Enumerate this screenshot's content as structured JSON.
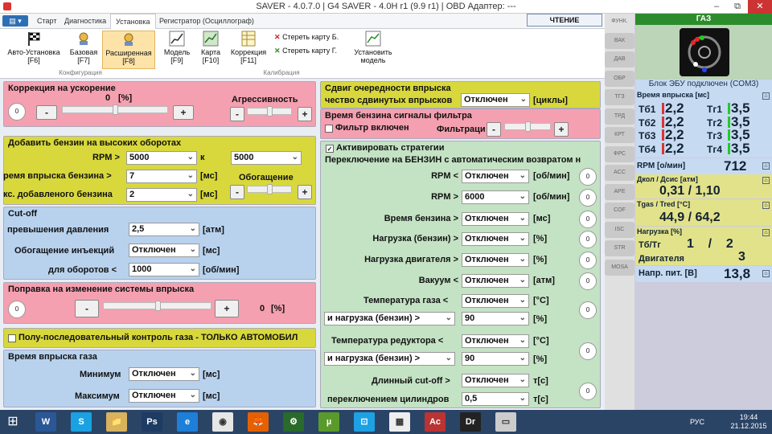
{
  "window": {
    "title": "SAVER - 4.0.7.0  |  G4 SAVER - 4.0H r1 (9.9 r1)  |  OBD Адаптер: ---",
    "min": "–",
    "max": "▭",
    "restore": "⧉",
    "close": "✕"
  },
  "menu": {
    "label": "▤ ▾"
  },
  "tabs": [
    "Старт",
    "Диагностика",
    "Установка",
    "Регистратор (Осциллограф)"
  ],
  "read_button": "ЧТЕНИЕ",
  "ribbon": {
    "auto": "Авто-Установка\n[F6]",
    "base": "Базовая\n[F7]",
    "ext": "Расширенная\n[F8]",
    "model": "Модель\n[F9]",
    "map": "Карта\n[F10]",
    "corr": "Коррекция\n[F11]",
    "erase_b": "Стереть карту Б.",
    "erase_g": "Стереть карту Г.",
    "install": "Установить\nмодель",
    "group_config": "Конфигурация",
    "group_calib": "Калибрация"
  },
  "accel": {
    "title": "Коррекция на ускорение",
    "value": "0",
    "unit": "[%]",
    "aggr": "Агрессивность",
    "minus": "-",
    "plus": "+",
    "circle": "0"
  },
  "addfuel": {
    "title": "Добавить бензин на высоких оборотах",
    "rpm_lbl": "RPM >",
    "rpm_val": "5000",
    "k": "к",
    "rpm_val2": "5000",
    "time_lbl": "ремя впрыска бензина >",
    "time_val": "7",
    "time_unit": "[мс]",
    "enrich": "Обогащение",
    "kc_lbl": "кс. добавленого бензина",
    "kc_val": "2",
    "kc_unit": "[мс]",
    "minus": "-",
    "plus": "+"
  },
  "cutoff": {
    "title": "Cut-off",
    "press_lbl": "превышения давления",
    "press_val": "2,5",
    "press_unit": "[атм]",
    "inj_lbl": "Обогащение инъекций",
    "inj_val": "Отключен",
    "inj_unit": "[мс]",
    "rev_lbl": "для оборотов <",
    "rev_val": "1000",
    "rev_unit": "[об/мин]"
  },
  "inj_change": {
    "title": "Поправка на изменение системы впрыска",
    "circle": "0",
    "minus": "-",
    "plus": "+",
    "value": "0",
    "unit": "[%]"
  },
  "semiseq": {
    "label": "Полу-последовательный контроль газа - ТОЛЬКО АВТОМОБИЛ"
  },
  "gastime": {
    "title": "Время впрыска газа",
    "min_lbl": "Минимум",
    "min_val": "Отключен",
    "min_unit": "[мс]",
    "max_lbl": "Максимум",
    "max_val": "Отключен",
    "max_unit": "[мс]"
  },
  "shift": {
    "title": "Сдвиг очередности впрыска",
    "lbl": "чество сдвинутых впрысков",
    "val": "Отключен",
    "unit": "[циклы]"
  },
  "filter": {
    "title": "Время бензина сигналы фильтра",
    "chk": "Фильтр включен",
    "filt_lbl": "Фильтраци",
    "minus": "-",
    "plus": "+"
  },
  "strategy": {
    "chk": "Активировать стратегии",
    "title": "Переключение на БЕНЗИН с автоматическим возвратом н",
    "rows": [
      {
        "lbl": "RPM <",
        "val": "Отключен",
        "unit": "[об/мин]",
        "c": "0"
      },
      {
        "lbl": "RPM >",
        "val": "6000",
        "unit": "[об/мин]",
        "c": "0"
      },
      {
        "lbl": "Время бензина >",
        "val": "Отключен",
        "unit": "[мс]",
        "c": "0"
      },
      {
        "lbl": "Нагрузка (бензин) >",
        "val": "Отключен",
        "unit": "[%]",
        "c": "0"
      },
      {
        "lbl": "Нагрузка двигателя >",
        "val": "Отключен",
        "unit": "[%]",
        "c": "0"
      },
      {
        "lbl": "Вакуум <",
        "val": "Отключен",
        "unit": "[атм]",
        "c": "0"
      }
    ],
    "tgas_lbl": "Температура газа <",
    "tgas_val": "Отключен",
    "tgas_unit": "[°C]",
    "tgas_and": "и нагрузка (бензин) >",
    "tgas_and_val": "90",
    "tgas_and_unit": "[%]",
    "tgas_c": "0",
    "tred_lbl": "Температура редуктора <",
    "tred_val": "Отключен",
    "tred_unit": "[°C]",
    "tred_and": "и нагрузка (бензин) >",
    "tred_and_val": "90",
    "tred_and_unit": "[%]",
    "tred_c": "0",
    "long_lbl": "Длинный cut-off >",
    "long_val": "Отключен",
    "long_unit": "т[c]",
    "sw_lbl": "переключением цилиндров",
    "sw_val": "0,5",
    "sw_unit": "т[c]",
    "long_c": "0"
  },
  "sidebar": [
    "ФУНК.",
    "ВАК",
    "ДАВ",
    "ОБР",
    "ТГЗ",
    "ТРД",
    "КРТ",
    "ФРС",
    "ACC",
    "APE",
    "COF",
    "ISC",
    "STR",
    "MOSA"
  ],
  "right": {
    "gas": "ГАЗ",
    "ecu": "Блок ЭБУ подключен (COM3)",
    "inj_title": "Время впрыска [мс]",
    "tb": [
      {
        "l": "Tб1",
        "v": "2,2"
      },
      {
        "l": "Tб2",
        "v": "2,2"
      },
      {
        "l": "Tб3",
        "v": "2,2"
      },
      {
        "l": "Tб4",
        "v": "2,2"
      }
    ],
    "tg": [
      {
        "l": "Tг1",
        "v": "3,5"
      },
      {
        "l": "Tг2",
        "v": "3,5"
      },
      {
        "l": "Tг3",
        "v": "3,5"
      },
      {
        "l": "Tг4",
        "v": "3,5"
      }
    ],
    "rpm_lbl": "RPM [о/мин]",
    "rpm_val": "712",
    "p_lbl": "Дкол / Дсис [атм]",
    "p_val": "0,31  /  1,10",
    "t_lbl": "Tgas / Tred [°C]",
    "t_val": "44,9  /  64,2",
    "load_lbl": "Нагрузка [%]",
    "load_tb": "Тб/Тг",
    "load_tb_v": "1    /    2",
    "load_eng": "Двигателя",
    "load_eng_v": "3",
    "volt_lbl": "Напр. пит. [В]",
    "volt_val": "13,8"
  },
  "taskbar": {
    "lang": "РУС",
    "time": "19:44",
    "date": "21.12.2015",
    "apps": [
      "W",
      "S",
      "📁",
      "Ps",
      "e",
      "◉",
      "🦊",
      "⚙",
      "µ",
      "⊡",
      "▦",
      "Ac",
      "Dr",
      "▭"
    ]
  }
}
